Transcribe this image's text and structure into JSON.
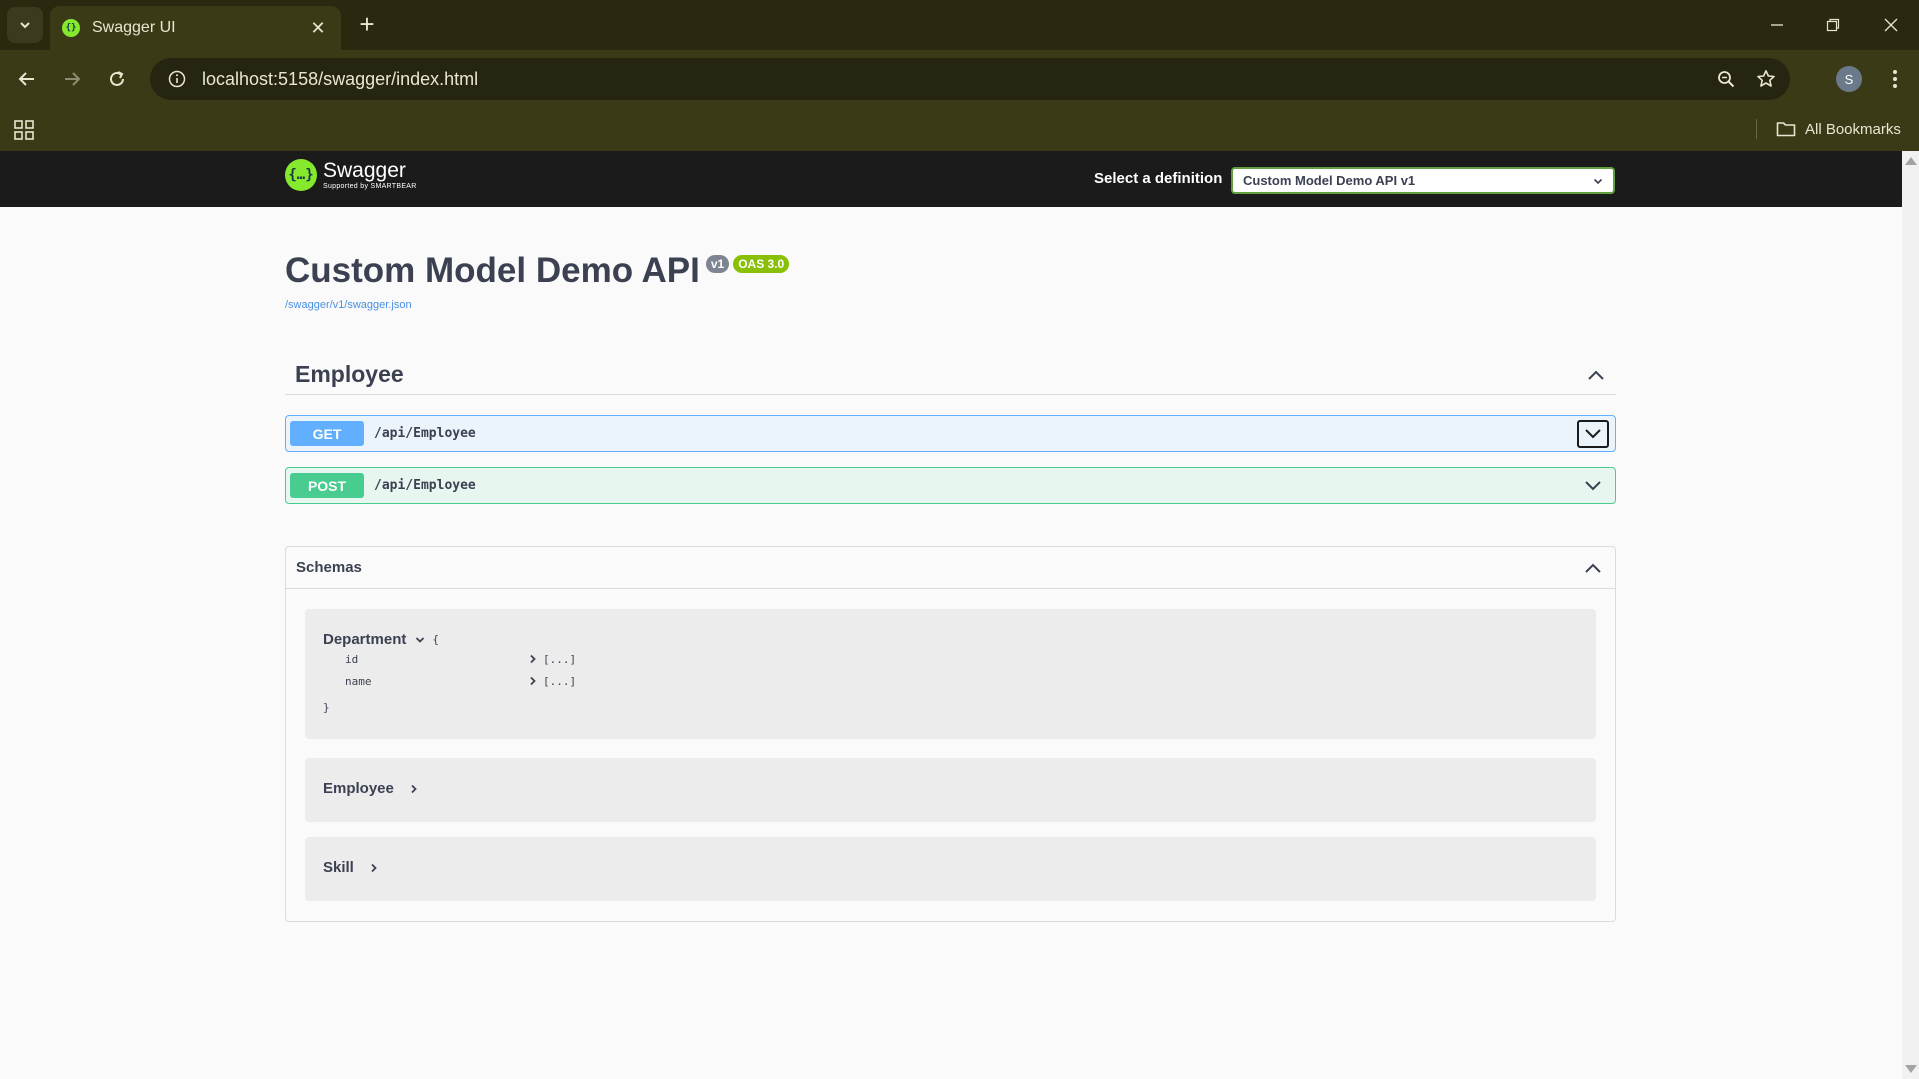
{
  "browser": {
    "tab_title": "Swagger UI",
    "tab_close_glyph": "✕",
    "new_tab_glyph": "+",
    "url": "localhost:5158/swagger/index.html",
    "bookmarks_label": "All Bookmarks",
    "profile_initial": "S"
  },
  "swagger": {
    "logo_name": "Swagger",
    "logo_sub": "Supported by SMARTBEAR",
    "definition_label": "Select a definition",
    "definition_selected": "Custom Model Demo API v1",
    "api_title": "Custom Model Demo API",
    "version_badge": "v1",
    "oas_badge": "OAS 3.0",
    "spec_link": "/swagger/v1/swagger.json",
    "tag": "Employee",
    "operations": [
      {
        "method": "GET",
        "path": "/api/Employee"
      },
      {
        "method": "POST",
        "path": "/api/Employee"
      }
    ],
    "schemas_title": "Schemas",
    "models": [
      {
        "name": "Department",
        "open_brace": "{",
        "close_brace": "}",
        "properties": [
          {
            "name": "id",
            "value": "[...]"
          },
          {
            "name": "name",
            "value": "[...]"
          }
        ]
      },
      {
        "name": "Employee"
      },
      {
        "name": "Skill"
      }
    ]
  },
  "colors": {
    "get": "#61affe",
    "post": "#49cc90",
    "swagger_green": "#85ea2d",
    "topbar": "#1b1b1b"
  }
}
